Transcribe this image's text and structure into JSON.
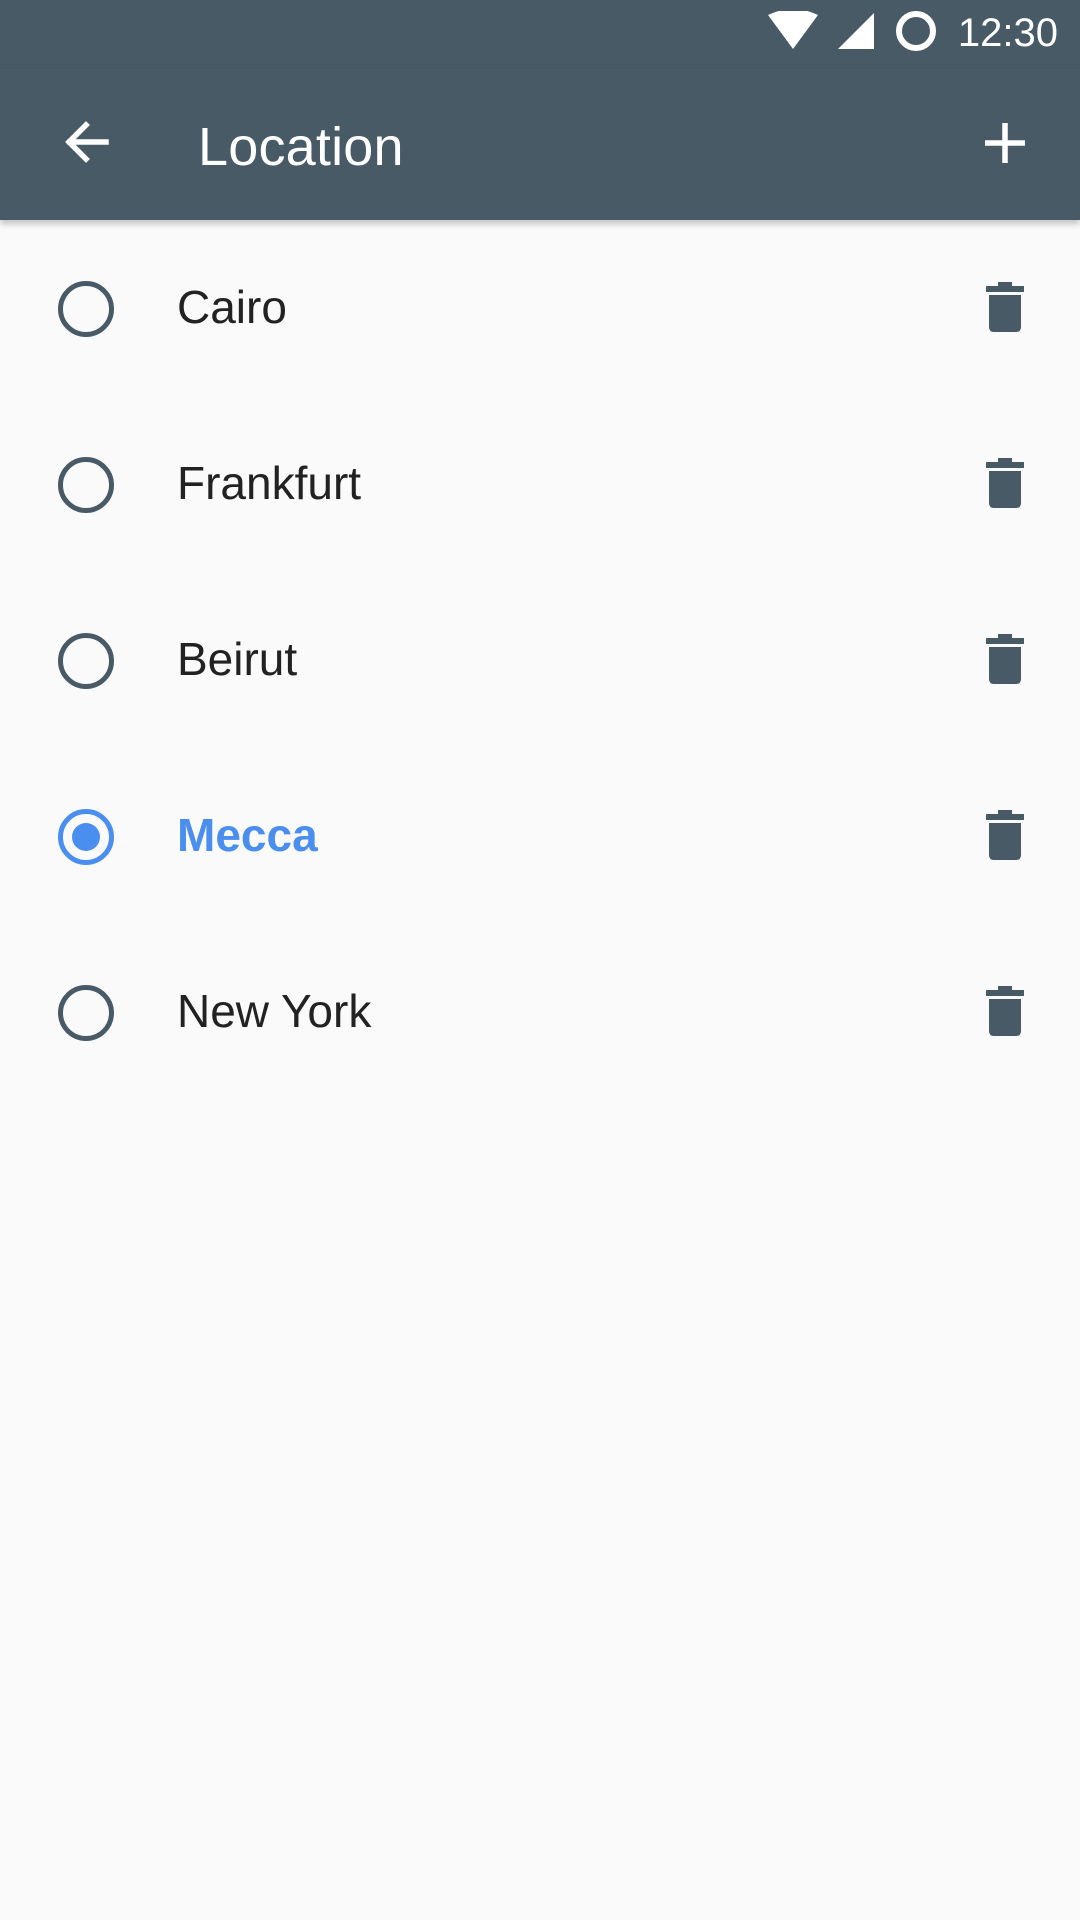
{
  "status_bar": {
    "time": "12:30",
    "icons": [
      "wifi-icon",
      "cellular-signal-icon",
      "sync-circle-icon"
    ]
  },
  "app_bar": {
    "title": "Location",
    "back_icon": "arrow-back-icon",
    "add_icon": "plus-icon"
  },
  "locations": [
    {
      "name": "Cairo",
      "selected": false
    },
    {
      "name": "Frankfurt",
      "selected": false
    },
    {
      "name": "Beirut",
      "selected": false
    },
    {
      "name": "Mecca",
      "selected": true
    },
    {
      "name": "New York",
      "selected": false
    }
  ],
  "row_icons": {
    "delete": "trash-icon"
  },
  "colors": {
    "primary": "#475a66",
    "accent": "#4a8ef0",
    "background": "#fafafa",
    "text": "#222222"
  }
}
